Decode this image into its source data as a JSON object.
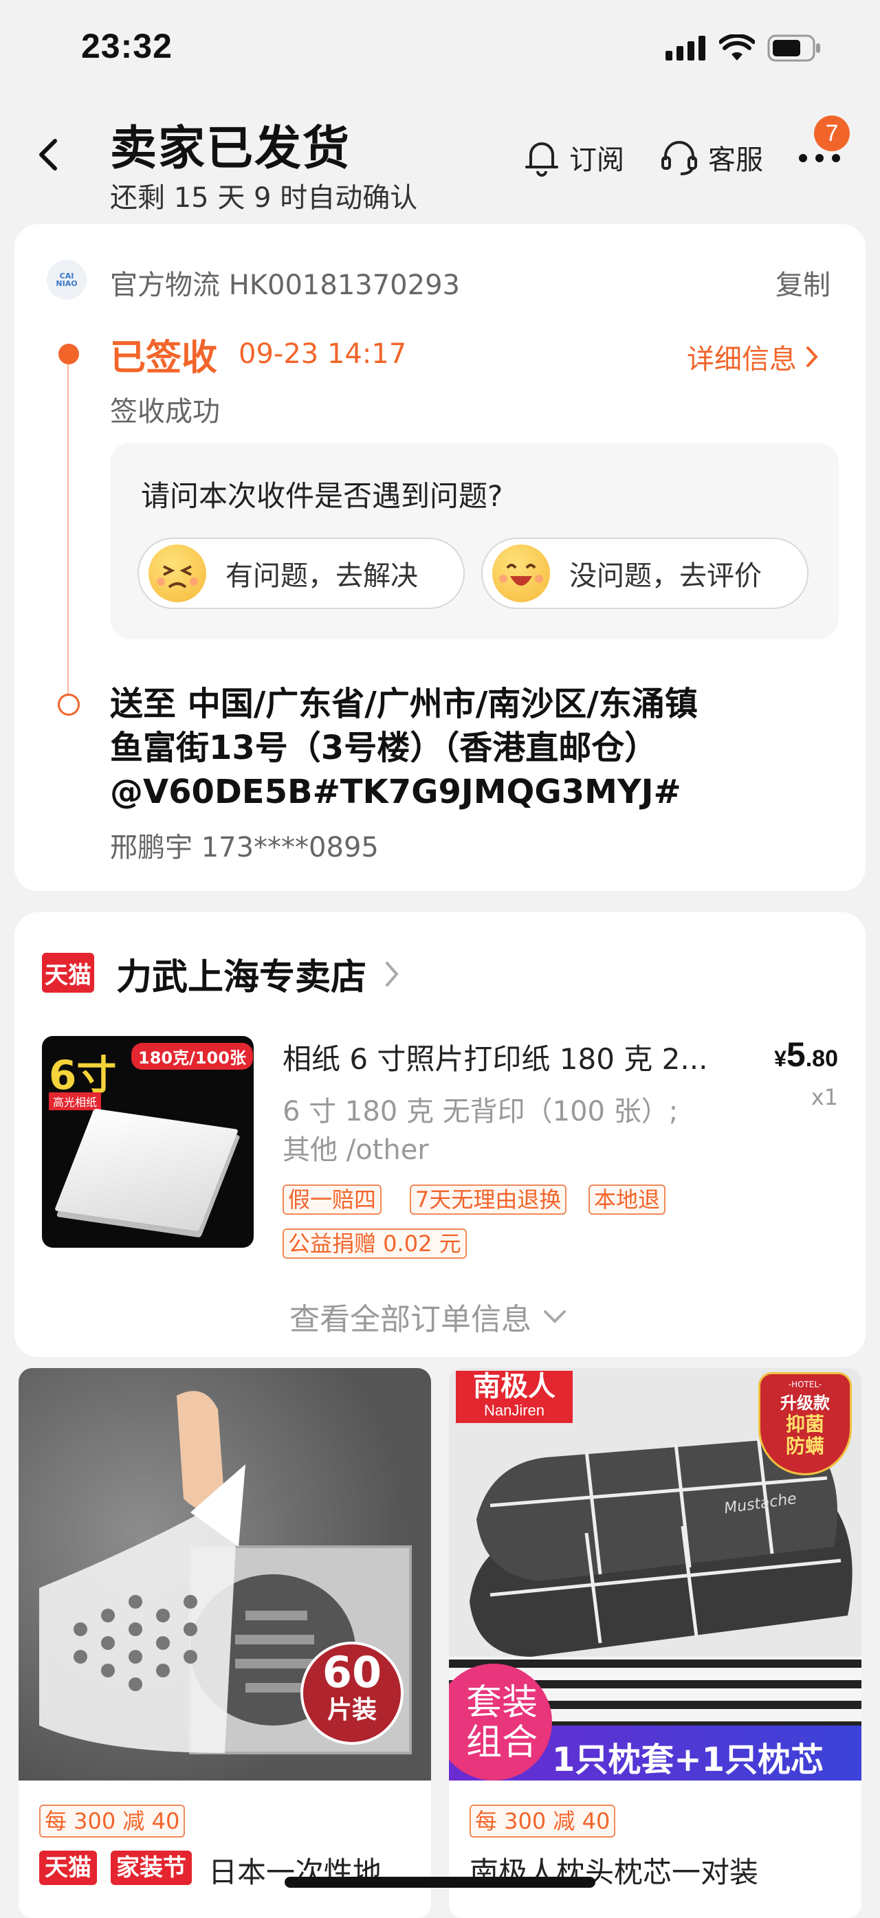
{
  "status_bar": {
    "time": "23:32"
  },
  "header": {
    "title": "卖家已发货",
    "subtitle": "还剩 15 天 9 时自动确认",
    "subscribe_label": "订阅",
    "service_label": "客服",
    "more_badge": "7"
  },
  "logistics": {
    "carrier_logo_text": "CAI NIAO",
    "tracking_label": "官方物流 HK00181370293",
    "copy_label": "复制",
    "status": "已签收",
    "status_time": "09-23 14:17",
    "detail_label": "详细信息",
    "sub_status": "签收成功",
    "question": "请问本次收件是否遇到问题?",
    "problem_button": "有问题，去解决",
    "no_problem_button": "没问题，去评价",
    "address_line1": "送至 中国/广东省/广州市/南沙区/东涌镇",
    "address_line2": "鱼富街13号（3号楼）（香港直邮仓）",
    "address_line3": "@V60DE5B#TK7G9JMQG3MYJ#",
    "recipient": "邢鹏宇 173****0895"
  },
  "order": {
    "store_badge": "天猫",
    "store_name": "力武上海专卖店",
    "product": {
      "image_big_text": "6寸",
      "image_tag": "180克/100张",
      "image_sub_tag": "高光相纸",
      "title": "相纸 6 寸照片打印纸 180 克 2...",
      "price_symbol": "¥",
      "price_int": "5",
      "price_dec": ".80",
      "quantity": "x1",
      "spec_line1": "6 寸 180 克 无背印（100 张）;",
      "spec_line2": "其他 /other",
      "tags": [
        "假一赔四",
        "7天无理由退换",
        "本地退"
      ],
      "charity_tag": "公益捐赠 0.02 元"
    },
    "view_all_label": "查看全部订单信息"
  },
  "recommendations": [
    {
      "promo_tag": "每 300 减 40",
      "badge1": "天猫",
      "badge2": "家装节",
      "title": "日本一次性地",
      "image_badge_num": "60",
      "image_badge_unit": "片装"
    },
    {
      "brand": "南极人",
      "brand_en": "NanJiren",
      "hotel_tag_top": "-HOTEL-",
      "hotel_tag_mid": "升级款",
      "hotel_tag_bottom1": "抑菌",
      "hotel_tag_bottom2": "防螨",
      "pillow_text": "Mustache",
      "set_label_line1": "套装",
      "set_label_line2": "组合",
      "set_banner": "1只枕套+1只枕芯",
      "promo_tag": "每 300 减 40",
      "title": "南极人枕头枕芯一对装"
    }
  ]
}
